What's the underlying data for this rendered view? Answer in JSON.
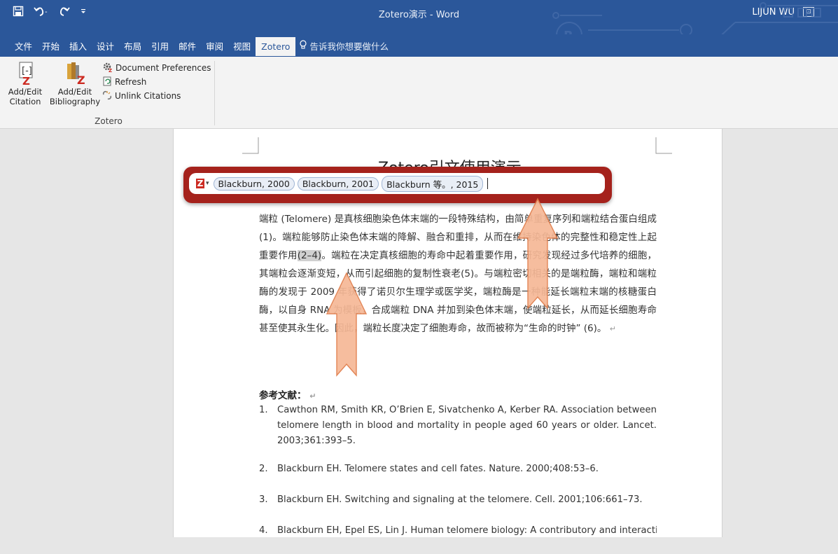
{
  "titlebar": {
    "title": "Zotero演示 - Word",
    "user": "LIJUN WU",
    "icons": [
      "save-icon",
      "undo-icon",
      "redo-icon",
      "customize-icon"
    ]
  },
  "menu": {
    "tabs": [
      "文件",
      "开始",
      "插入",
      "设计",
      "布局",
      "引用",
      "邮件",
      "审阅",
      "视图",
      "Zotero"
    ],
    "active_tab": "Zotero",
    "tell_me": "告诉我你想要做什么"
  },
  "ribbon": {
    "add_edit_citation": [
      "Add/Edit",
      "Citation"
    ],
    "add_edit_bibliography": [
      "Add/Edit",
      "Bibliography"
    ],
    "document_preferences": "Document Preferences",
    "refresh": "Refresh",
    "unlink_citations": "Unlink Citations",
    "group_label": "Zotero"
  },
  "quick_format": {
    "citations": [
      "Blackburn, 2000",
      "Blackburn, 2001",
      "Blackburn 等。, 2015"
    ]
  },
  "document": {
    "title": "Zotero引文使用演示",
    "para_before_hl": "端粒 (Telomere) 是真核细胞染色体末端的一段特殊结构，由简单重复序列和端粒结合蛋白组成(1)。端粒能够防止染色体末端的降解、融合和重排，从而在维持染色体的完整性和稳定性上起重要作用",
    "highlight": "(2–4)",
    "para_after_hl": "。端粒在决定真核细胞的寿命中起着重要作用，研究发现经过多代培养的细胞，其端粒会逐渐变短，从而引起细胞的复制性衰老(5)。与端粒密切相关的是端粒酶，端粒和端粒酶的发现于 2009 年获得了诺贝尔生理学或医学奖，端粒酶是一种能延长端粒末端的核糖蛋白酶，以自身 RNA 为模板，合成端粒 DNA 并加到染色体末端，使端粒延长，从而延长细胞寿命甚至使其永生化。因此，端粒长度决定了细胞寿命，故而被称为“生命的时钟” (6)。",
    "references_heading": "参考文献：",
    "references": [
      {
        "num": "1.",
        "text": "Cawthon RM, Smith KR, O’Brien E, Sivatchenko A, Kerber RA. Association between telomere length in blood and mortality in people aged 60 years or older. Lancet. 2003;361:393–5."
      },
      {
        "num": "2.",
        "text": "Blackburn EH. Telomere states and cell fates. Nature. 2000;408:53–6."
      },
      {
        "num": "3.",
        "text": "Blackburn EH. Switching and signaling at the telomere. Cell. 2001;106:661–73."
      },
      {
        "num": "4.",
        "text": "Blackburn EH, Epel ES, Lin J. Human telomere biology: A contributory and interactive"
      }
    ]
  },
  "colors": {
    "word_blue": "#2b579a",
    "quick_format_frame": "#a5221c",
    "arrow_fill": "#f6b896",
    "arrow_stroke": "#e07b48"
  }
}
